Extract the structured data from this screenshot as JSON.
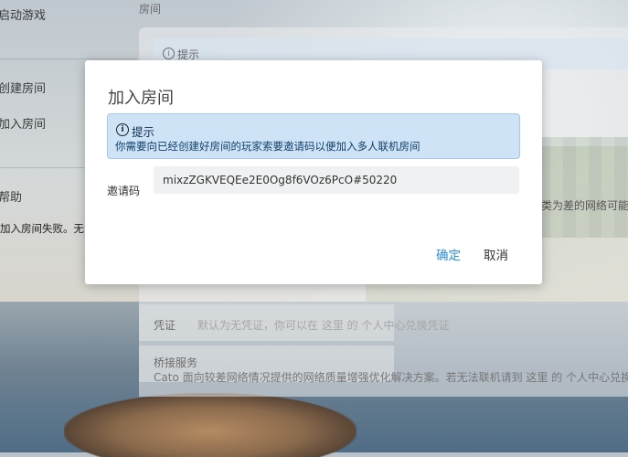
{
  "sidebar": {
    "items": [
      {
        "label": "启动游戏"
      },
      {
        "label": "创建房间"
      },
      {
        "label": "加入房间"
      },
      {
        "label": "帮助"
      }
    ]
  },
  "background_page": {
    "section_label": "房间",
    "hint_label": "提示",
    "credential": {
      "label": "凭证",
      "value": "默认为无凭证，你可以在 这里 的 个人中心兑换凭证"
    },
    "bridge": {
      "label": "桥接服务",
      "desc": "Cato 面向较差网络情况提供的网络质量增强优化解决方案。若无法联机请到 这里 的 个人中心兑换"
    },
    "right_snippet": "类为差的网络可能导"
  },
  "status_message": "加入房间失败。无法与对方建立连接。如果你或对方的网络类型是差（对称型），可能无法使用联机功能。",
  "dialog": {
    "title": "加入房间",
    "info": {
      "heading": "提示",
      "body": "你需要向已经创建好房间的玩家索要邀请码以便加入多人联机房间"
    },
    "invite_code_label": "邀请码",
    "invite_code_value": "mixzZGKVEQEe2E0Og8f6VOz6PcO#50220",
    "confirm_label": "确定",
    "cancel_label": "取消"
  },
  "colors": {
    "accent": "#2b8fd6",
    "info_bg": "#cfe3f6"
  }
}
